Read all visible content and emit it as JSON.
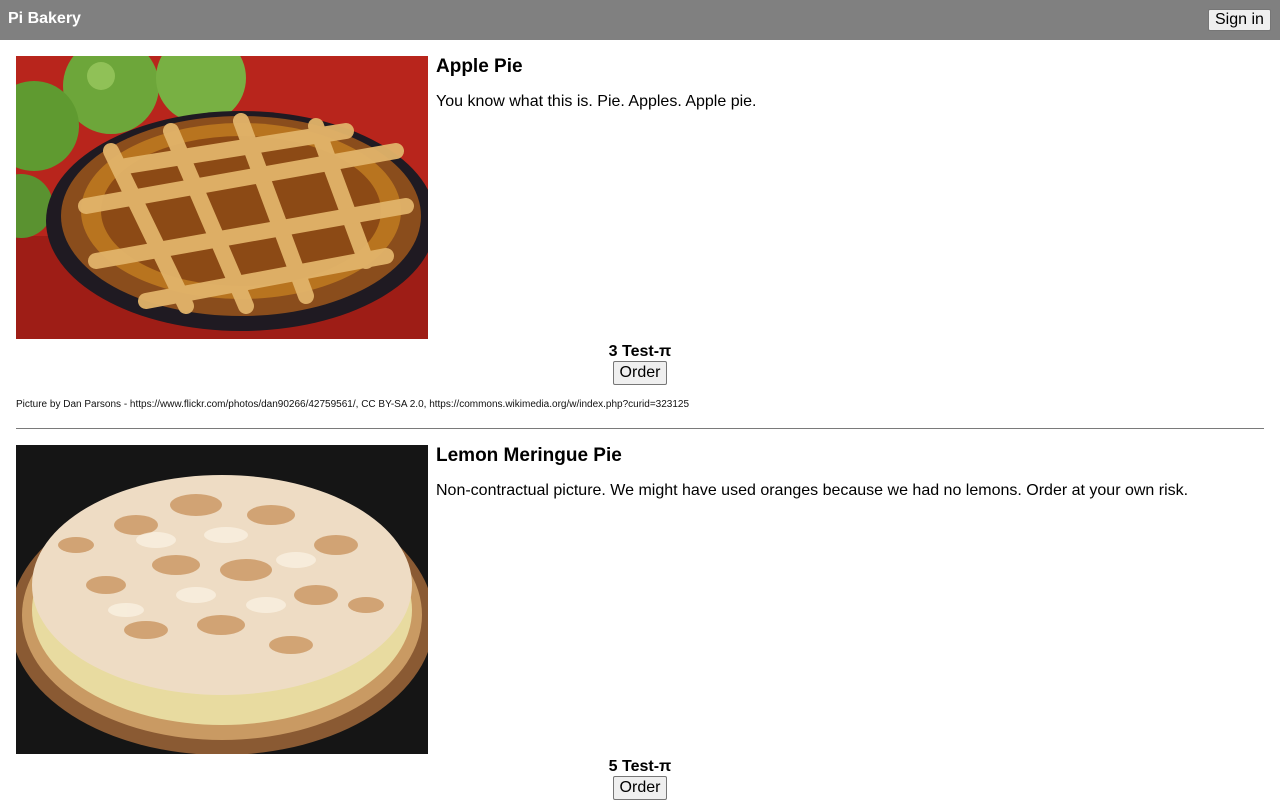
{
  "header": {
    "brand": "Pi Bakery",
    "sign_in_label": "Sign in"
  },
  "products": [
    {
      "name": "Apple Pie",
      "description": "You know what this is. Pie. Apples. Apple pie.",
      "price": "3 Test-π",
      "order_label": "Order",
      "credit": "Picture by Dan Parsons - https://www.flickr.com/photos/dan90266/42759561/, CC BY-SA 2.0, https://commons.wikimedia.org/w/index.php?curid=323125",
      "image_alt": "apple-pie-photo"
    },
    {
      "name": "Lemon Meringue Pie",
      "description": "Non-contractual picture. We might have used oranges because we had no lemons. Order at your own risk.",
      "price": "5 Test-π",
      "order_label": "Order",
      "image_alt": "lemon-meringue-pie-photo"
    }
  ],
  "colors": {
    "header_bg": "#808080",
    "header_text": "#ffffff",
    "divider": "#7a7a7a"
  }
}
